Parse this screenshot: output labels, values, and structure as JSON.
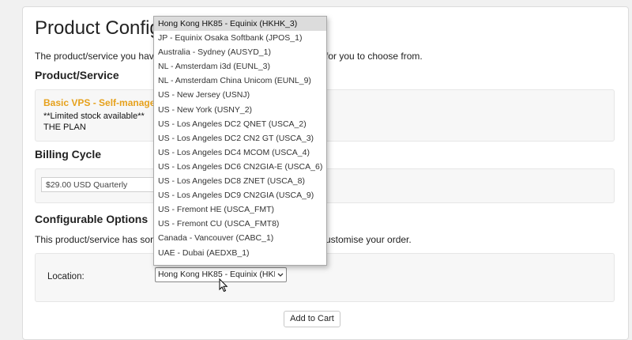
{
  "page": {
    "title": "Product Configur",
    "intro_left": "The product/service you have c",
    "intro_right": "for you to choose from."
  },
  "product_section": {
    "heading": "Product/Service",
    "product_name": "Basic VPS - Self-managed -",
    "stock_note": "**Limited stock available**",
    "plan": "THE PLAN"
  },
  "billing": {
    "heading": "Billing Cycle",
    "selected": "$29.00 USD Quarterly"
  },
  "options": {
    "heading": "Configurable Options",
    "intro_left": "This product/service has some",
    "intro_right": "ustomise your order.",
    "location_label": "Location:",
    "location_selected": "Hong Kong HK85 - Equinix (HKHK_3)"
  },
  "dropdown": {
    "options": [
      "Hong Kong HK85 - Equinix (HKHK_3)",
      "JP - Equinix Osaka Softbank (JPOS_1)",
      "Australia - Sydney (AUSYD_1)",
      "NL - Amsterdam i3d (EUNL_3)",
      "NL - Amsterdam China Unicom (EUNL_9)",
      "US - New Jersey (USNJ)",
      "US - New York (USNY_2)",
      "US - Los Angeles DC2 QNET (USCA_2)",
      "US - Los Angeles DC2 CN2 GT (USCA_3)",
      "US - Los Angeles DC4 MCOM (USCA_4)",
      "US - Los Angeles DC6 CN2GIA-E (USCA_6)",
      "US - Los Angeles DC8 ZNET (USCA_8)",
      "US - Los Angeles DC9 CN2GIA (USCA_9)",
      "US - Fremont HE (USCA_FMT)",
      "US - Fremont CU (USCA_FMT8)",
      "Canada - Vancouver (CABC_1)",
      "UAE - Dubai (AEDXB_1)"
    ],
    "selected_index": 0
  },
  "actions": {
    "add_to_cart": "Add to Cart"
  },
  "colors": {
    "accent": "#e6a11c",
    "selected_option_bg": "#dcdcdc"
  }
}
